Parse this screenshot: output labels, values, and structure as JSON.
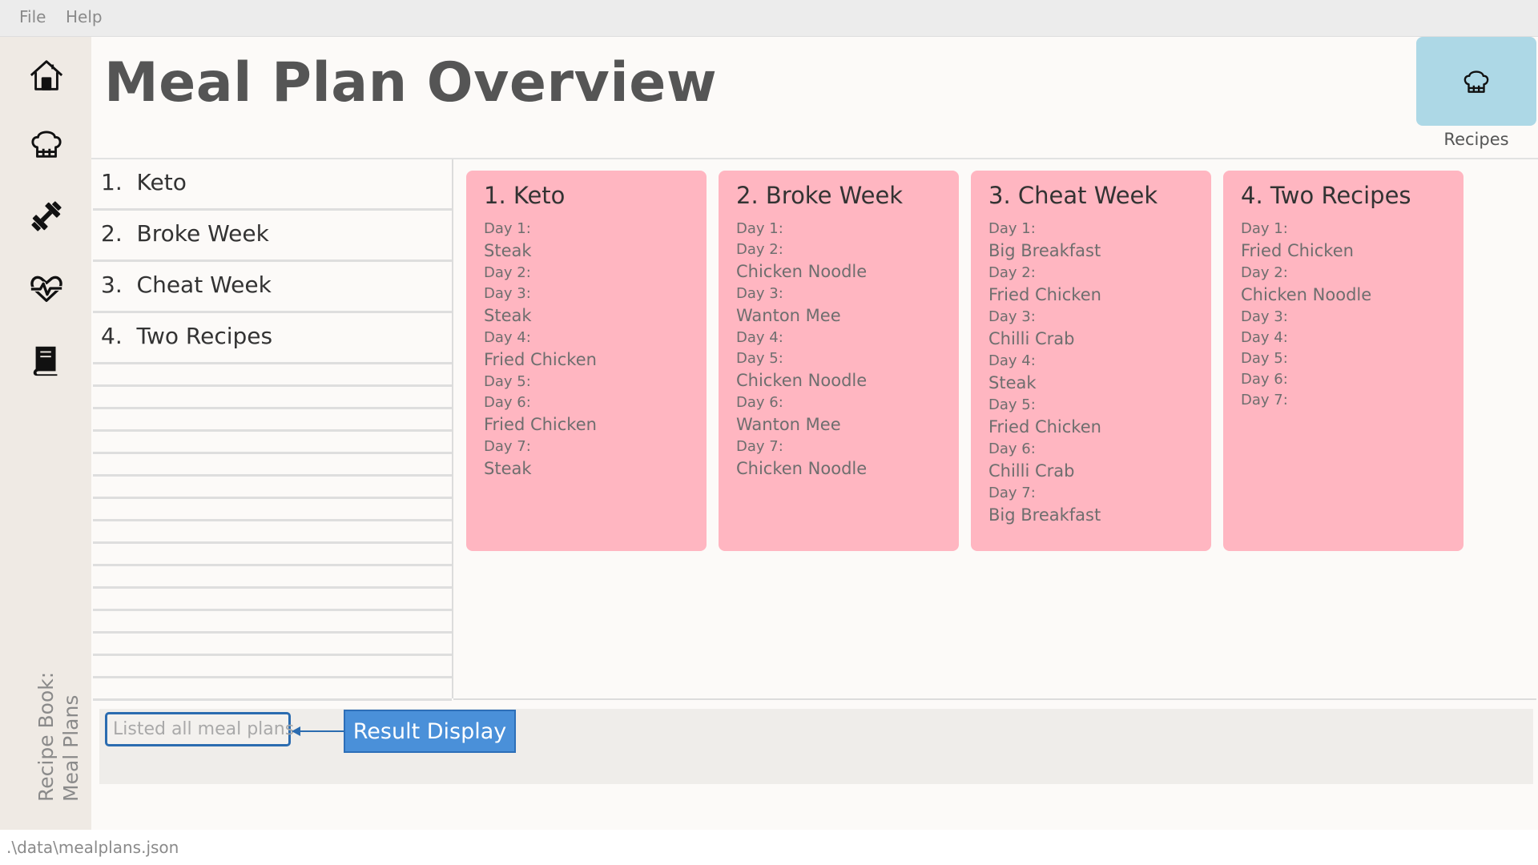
{
  "menu": {
    "file": "File",
    "help": "Help"
  },
  "sidebar": {
    "title_line1": "Recipe Book:",
    "title_line2": "Meal Plans",
    "icons": [
      "home-icon",
      "chef-hat-icon",
      "dumbbell-icon",
      "heartbeat-icon",
      "book-icon"
    ]
  },
  "header": {
    "title": "Meal Plan Overview",
    "recipes_button_label": "Recipes",
    "recipes_button_icon": "chef-hat-icon",
    "recipes_button_color": "#add8e6"
  },
  "list": [
    {
      "index": "1.",
      "name": "Keto"
    },
    {
      "index": "2.",
      "name": "Broke Week"
    },
    {
      "index": "3.",
      "name": "Cheat Week"
    },
    {
      "index": "4.",
      "name": "Two Recipes"
    }
  ],
  "cards": [
    {
      "title": "1.  Keto",
      "lines": [
        "Day 1:",
        "Steak",
        "Day 2:",
        "Day 3:",
        "Steak",
        "Day 4:",
        "Fried Chicken",
        "Day 5:",
        "Day 6:",
        "Fried Chicken",
        "Day 7:",
        "Steak"
      ]
    },
    {
      "title": "2.  Broke Week",
      "lines": [
        "Day 1:",
        "Day 2:",
        "Chicken Noodle",
        "Day 3:",
        "Wanton Mee",
        "Day 4:",
        "Day 5:",
        "Chicken Noodle",
        "Day 6:",
        "Wanton Mee",
        "Day 7:",
        "Chicken Noodle"
      ]
    },
    {
      "title": "3.  Cheat Week",
      "lines": [
        "Day 1:",
        "Big Breakfast",
        "Day 2:",
        "Fried Chicken",
        "Day 3:",
        "Chilli Crab",
        "Day 4:",
        "Steak",
        "Day 5:",
        "Fried Chicken",
        "Day 6:",
        "Chilli Crab",
        "Day 7:",
        "Big Breakfast"
      ]
    },
    {
      "title": "4.  Two Recipes",
      "lines": [
        "Day 1:",
        "Fried Chicken",
        "Day 2:",
        "Chicken Noodle",
        "Day 3:",
        "Day 4:",
        "Day 5:",
        "Day 6:",
        "Day 7:"
      ]
    }
  ],
  "card_color": "#ffb6c1",
  "result": {
    "text": "Listed all meal plans",
    "callout": "Result Display",
    "callout_color": "#4a90d9"
  },
  "status": {
    "path": ".\\data\\mealplans.json"
  }
}
